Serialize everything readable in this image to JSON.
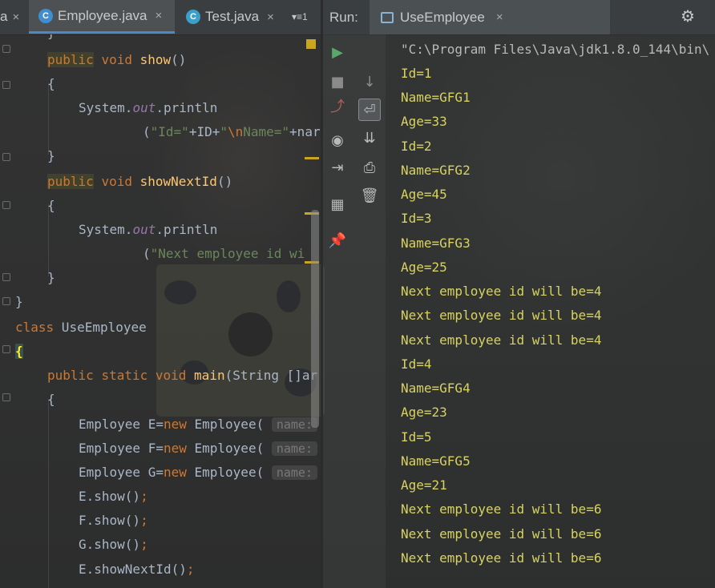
{
  "tabs": {
    "partial": "a",
    "employee": "Employee.java",
    "test": "Test.java",
    "overflow": "▾≡1",
    "close": "×"
  },
  "code": {
    "l0": "}",
    "public": "public",
    "void": "void",
    "show": "show",
    "parens": "()",
    "ob": "{",
    "cb": "}",
    "system": "System.",
    "out": "out",
    "println": ".println",
    "args1a": "(",
    "args1b": "\"Id=\"",
    "args1c": "+ID+",
    "args1d": "\"",
    "args1e": "\\n",
    "args1f": "Name=\"",
    "args1g": "+nar",
    "showNextId": "showNextId",
    "args2a": "(",
    "args2b": "\"Next employee id wi",
    "classKw": "class",
    "className": " UseEmployee",
    "static": "static",
    "main": "main",
    "mainArgs": "(String []ar",
    "empE": "Employee E=",
    "empF": "Employee F=",
    "empG": "Employee G=",
    "new": "new",
    "ctor": " Employee(",
    "hint": "name:",
    "eshow": "E.show",
    "fshow": "F.show",
    "gshow": "G.show",
    "call": "()",
    "semi": ";",
    "enext": "E.showNextId"
  },
  "run": {
    "label": "Run:",
    "tab": "UseEmployee",
    "close": "×",
    "settings_icon": "gear-icon"
  },
  "console_lines": [
    "\"C:\\Program Files\\Java\\jdk1.8.0_144\\bin\\",
    "Id=1",
    "Name=GFG1",
    "Age=33",
    "Id=2",
    "Name=GFG2",
    "Age=45",
    "Id=3",
    "Name=GFG3",
    "Age=25",
    "Next employee id will be=4",
    "Next employee id will be=4",
    "Next employee id will be=4",
    "Id=4",
    "Name=GFG4",
    "Age=23",
    "Id=5",
    "Name=GFG5",
    "Age=21",
    "Next employee id will be=6",
    "Next employee id will be=6",
    "Next employee id will be=6"
  ],
  "toolbar_icons": [
    "run-icon",
    "stop-icon",
    "down-arrow-icon",
    "rerun-icon",
    "soft-wrap-icon",
    "camera-icon",
    "scroll-to-end-icon",
    "exit-icon",
    "print-icon",
    "trash-icon",
    "layout-icon",
    "pin-icon"
  ],
  "colors": {
    "keyword": "#cc7832",
    "method": "#ffc66d",
    "string": "#6a8759",
    "field": "#9876aa",
    "output": "#d8d360",
    "accent": "#4a88c7"
  }
}
